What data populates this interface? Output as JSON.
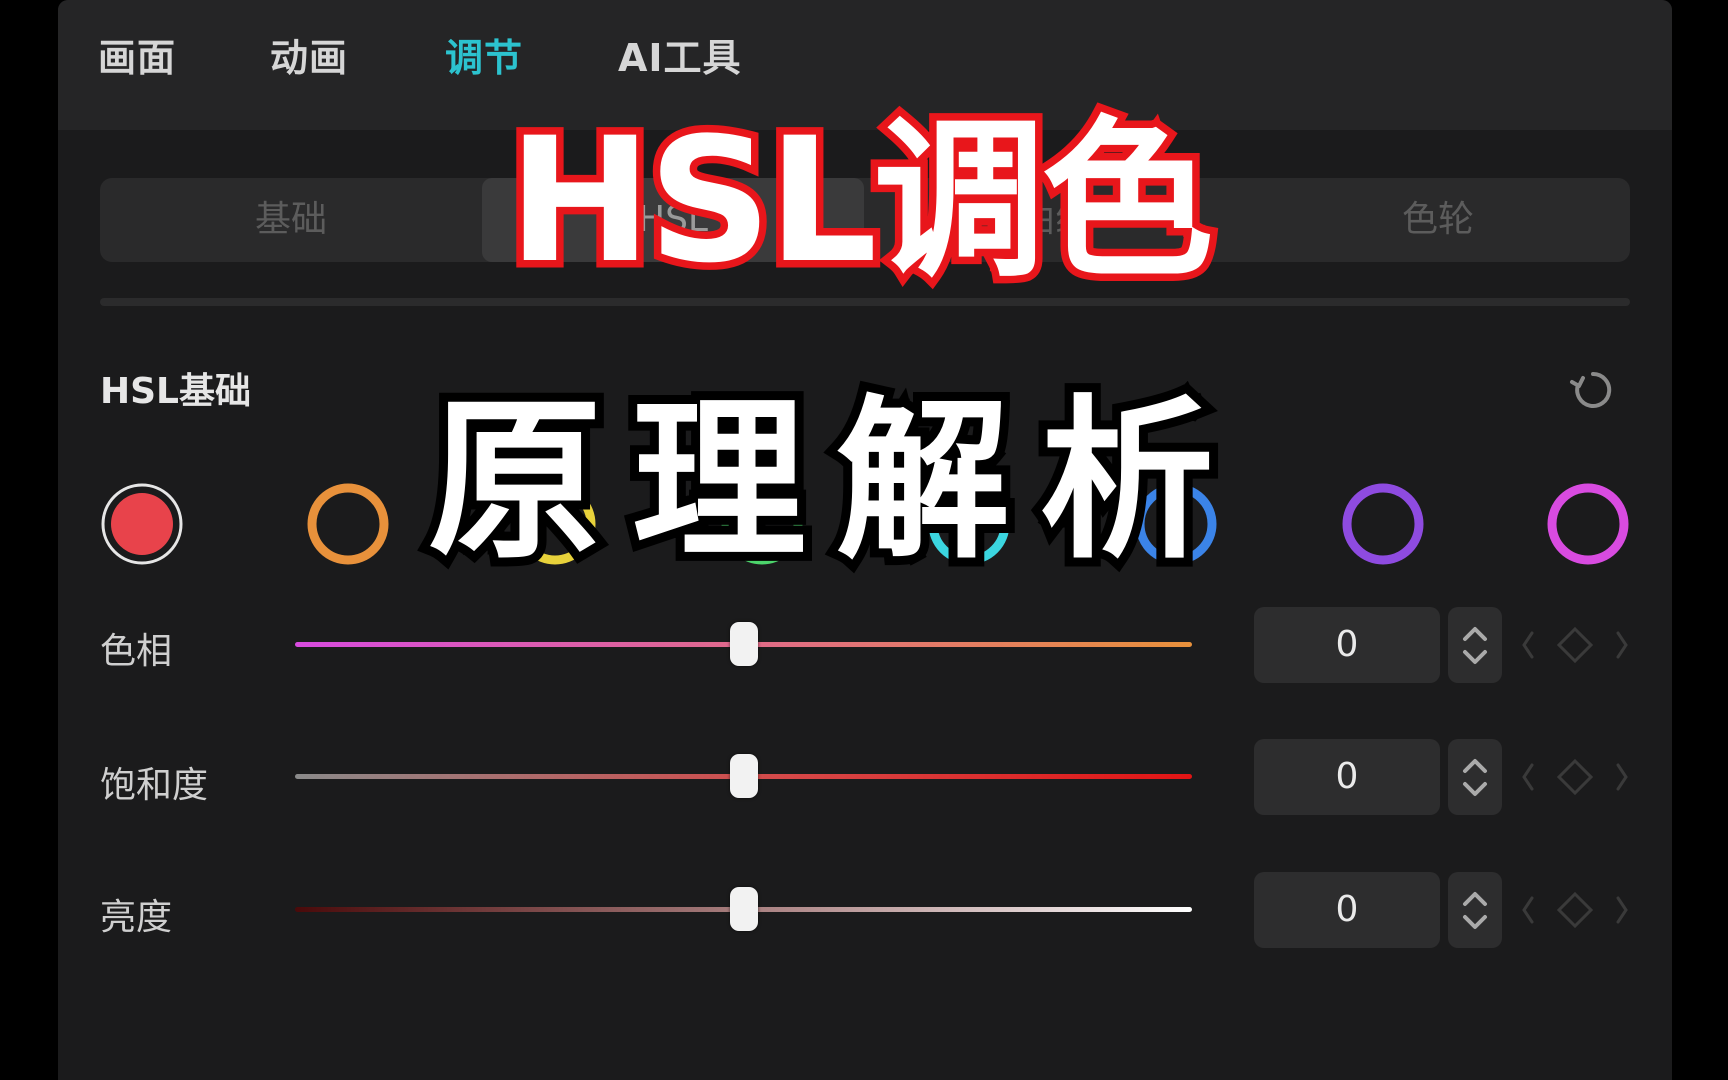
{
  "tabs": [
    {
      "label": "画面",
      "active": false
    },
    {
      "label": "动画",
      "active": false
    },
    {
      "label": "调节",
      "active": true
    },
    {
      "label": "AI工具",
      "active": false
    }
  ],
  "segments": [
    {
      "label": "基础",
      "active": false
    },
    {
      "label": "HSL",
      "active": true
    },
    {
      "label": "曲线",
      "active": false
    },
    {
      "label": "色轮",
      "active": false
    }
  ],
  "section": {
    "title": "HSL基础"
  },
  "colors": {
    "accent": "#2cc3cf",
    "swatches": [
      "#e8434b",
      "#e8913b",
      "#e8d23b",
      "#4cd46b",
      "#3bd6e0",
      "#3b84e8",
      "#8e4be0",
      "#d84be0"
    ]
  },
  "sliders": [
    {
      "label": "色相",
      "value": "0",
      "level": 0.5
    },
    {
      "label": "饱和度",
      "value": "0",
      "level": 0.5
    },
    {
      "label": "亮度",
      "value": "0",
      "level": 0.5
    }
  ],
  "overlay": {
    "title": "HSL调色",
    "subtitle": "原理解析"
  },
  "icons": [
    "reset-icon",
    "stepper-arrows-icon",
    "keyframe-prev-icon",
    "keyframe-diamond-icon",
    "keyframe-next-icon"
  ]
}
